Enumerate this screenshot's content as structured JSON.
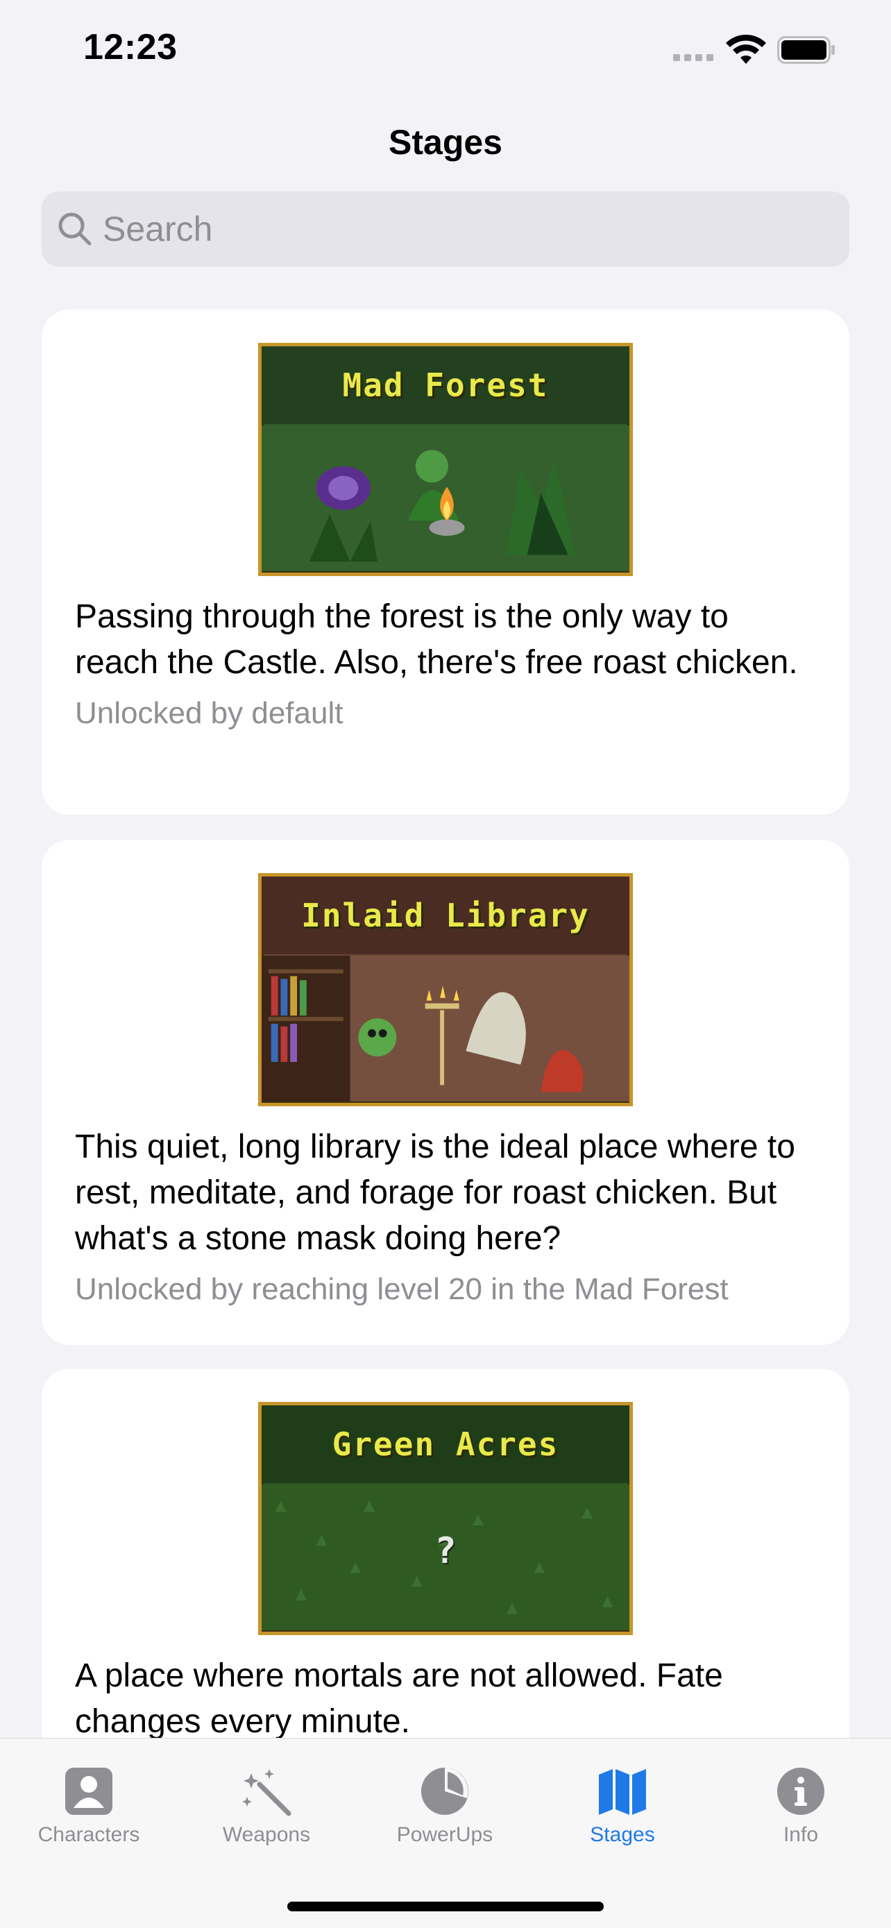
{
  "status_bar": {
    "time": "12:23",
    "icons": [
      "cellular-dots-icon",
      "wifi-icon",
      "battery-icon"
    ]
  },
  "nav": {
    "title": "Stages"
  },
  "search": {
    "placeholder": "Search",
    "value": ""
  },
  "stages": [
    {
      "banner_title": "Mad Forest",
      "description": "Passing through the forest is the only way to reach the Castle. Also, there's free roast chicken.",
      "unlock": "Unlocked by default"
    },
    {
      "banner_title": "Inlaid Library",
      "description": "This quiet, long library is the ideal place where to rest, meditate, and forage for roast chicken. But what's a stone mask doing here?",
      "unlock": "Unlocked by reaching level 20 in the Mad Forest"
    },
    {
      "banner_title": "Green Acres",
      "banner_symbol": "?",
      "description": "A place where mortals are not allowed. Fate changes every minute.",
      "unlock": ""
    }
  ],
  "tab_bar": {
    "tabs": [
      {
        "label": "Characters",
        "icon": "person-square-icon",
        "active": false
      },
      {
        "label": "Weapons",
        "icon": "magic-wand-icon",
        "active": false
      },
      {
        "label": "PowerUps",
        "icon": "pie-chart-icon",
        "active": false
      },
      {
        "label": "Stages",
        "icon": "map-icon",
        "active": true
      },
      {
        "label": "Info",
        "icon": "info-circle-icon",
        "active": false
      }
    ]
  },
  "colors": {
    "accent": "#1f7ae8",
    "inactive": "#8e8e93",
    "background": "#f2f2f7",
    "card": "#ffffff"
  }
}
